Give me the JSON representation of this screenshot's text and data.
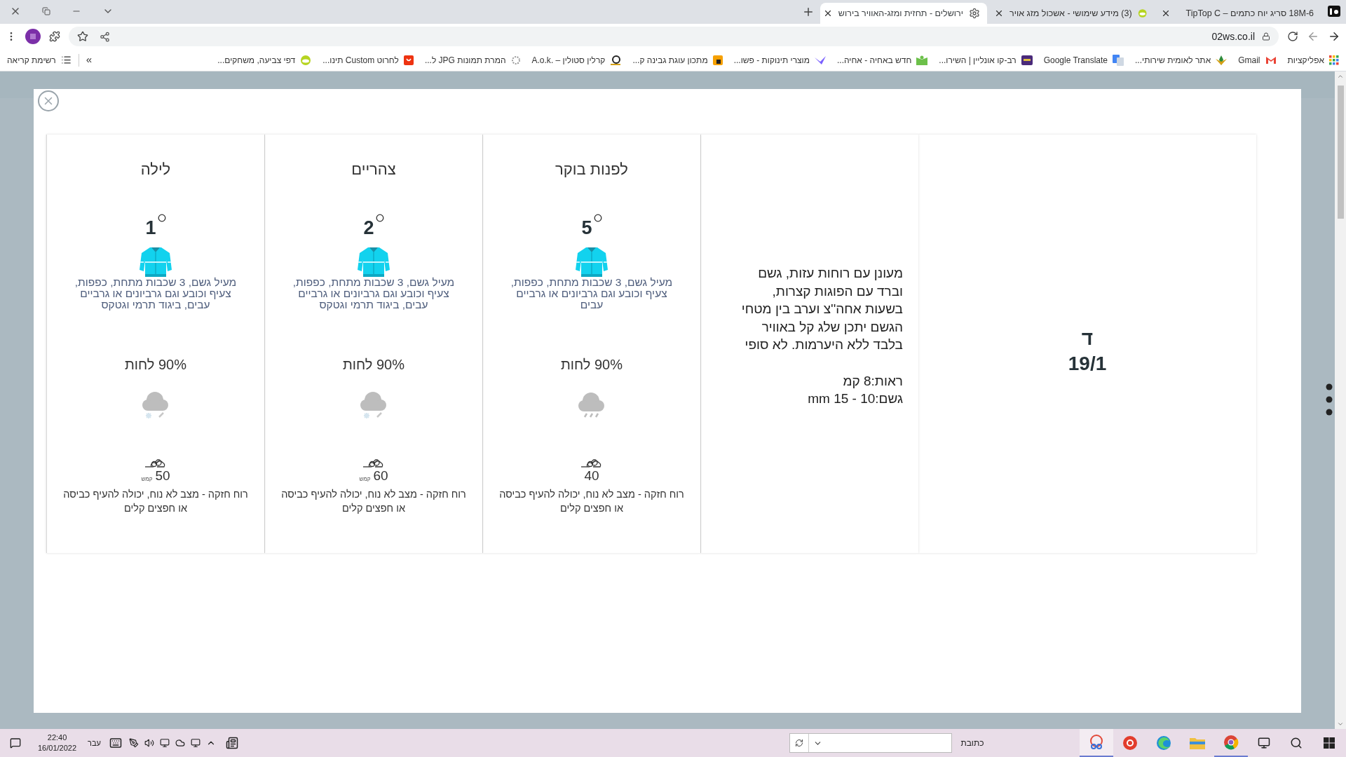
{
  "browser": {
    "tabs": [
      {
        "title": "18M-6 סריג יוח כתמים – TipTop C",
        "selected": false
      },
      {
        "title": "(3) מידע שימושי - אשכול מזג אויר",
        "selected": false
      },
      {
        "title": "ירושלים - תחזית ומזג-האוויר בירוש",
        "selected": true
      }
    ],
    "address": "02ws.co.il",
    "bookmarks": [
      "אפליקציות",
      "Gmail",
      "אתר לאומית שירותי...",
      "Google Translate",
      "רב-קו אונליין | השירו...",
      "חדש באחיה - אחיה...",
      "מוצרי תינוקות - פשו...",
      "מתכון עוגת גבינה ק...",
      "קרלין סטולין – .A.o.k",
      "המרת תמונות JPG ל...",
      "לחרוט Custom תינו...",
      "דפי צביעה, משחקים..."
    ],
    "more": "»",
    "reading_list": "רשימת קריאה"
  },
  "forecast": {
    "day": "ד",
    "date": "19/1",
    "summary": "מעונן עם רוחות עזות, גשם וברד עם הפוגות קצרות, בשעות אחה''צ וערב בין מטחי הגשם יתכן שלג קל באוויר בלבד ללא היערמות. לא סופי",
    "visibility": "ראות:8 קמ",
    "rain": "גשם:10 - 15 mm",
    "periods": [
      {
        "name": "לפנות בוקר",
        "temp": "5",
        "clothing": "מעיל גשם, 3 שכבות מתחת, כפפות, צעיף וכובע וגם גרביונים או גרביים עבים",
        "humidity": "90% לחות",
        "kind": "rain",
        "wind_speed": "40",
        "wind_text": "רוח חזקה - מצב לא נוח, יכולה להעיף כביסה או חפצים קלים"
      },
      {
        "name": "צהריים",
        "temp": "2",
        "clothing": "מעיל גשם, 3 שכבות מתחת, כפפות, צעיף וכובע וגם גרביונים או גרביים עבים, ביגוד תרמי וגטקס",
        "humidity": "90% לחות",
        "kind": "snow_sleet",
        "wind_speed": "60",
        "wind_unit": "קמש",
        "wind_text": "רוח חזקה - מצב לא נוח, יכולה להעיף כביסה או חפצים קלים"
      },
      {
        "name": "לילה",
        "temp": "1",
        "clothing": "מעיל גשם, 3 שכבות מתחת, כפפות, צעיף וכובע וגם גרביונים או גרביים עבים, ביגוד תרמי וגטקס",
        "humidity": "90% לחות",
        "kind": "snow_sleet",
        "wind_speed": "50",
        "wind_unit": "קמש",
        "wind_text": "רוח חזקה - מצב לא נוח, יכולה להעיף כביסה או חפצים קלים"
      }
    ]
  },
  "taskbar": {
    "address_label": "כתובת",
    "language": "עבר",
    "time": "22:40",
    "date": "16/01/2022"
  }
}
